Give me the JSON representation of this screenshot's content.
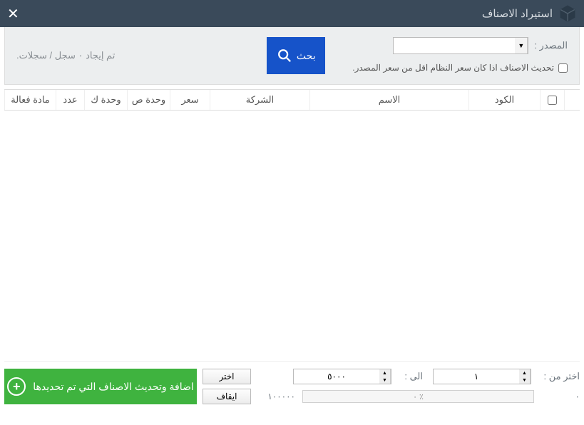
{
  "title": "استيراد الاصناف",
  "toolbar": {
    "source_label": "المصدر :",
    "source_value": "",
    "update_checkbox_label": "تحديث الاصناف اذا كان سعر النظام اقل من سعر المصدر.",
    "search_label": "بحث",
    "status_text": "تم إيجاد ٠ سجل / سجلات."
  },
  "grid": {
    "columns": {
      "code": "الكود",
      "name": "الاسم",
      "company": "الشركة",
      "price": "سعر",
      "unit_small": "وحدة ص",
      "unit_big": "وحدة ك",
      "qty": "عدد",
      "active": "مادة فعالة"
    },
    "rows": []
  },
  "footer": {
    "from_label": "اختر من :",
    "to_label": "الى :",
    "from_value": "١",
    "to_value": "٥٠٠٠",
    "count_value": "١٠٠٠٠٠",
    "progress_value": "٠",
    "progress_text": "٪ ٠",
    "select_btn": "اختر",
    "stop_btn": "ايقاف",
    "apply_btn": "اضافة وتحديث الاصناف التي تم تحديدها"
  }
}
